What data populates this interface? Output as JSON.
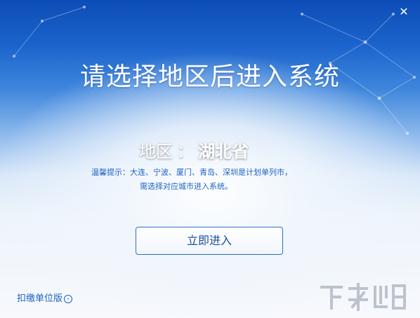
{
  "window": {
    "close_glyph": "✕"
  },
  "title": "请选择地区后进入系统",
  "region": {
    "label": "地区",
    "separator": "：",
    "value": "湖北省"
  },
  "tip": {
    "line1": "温馨提示：大连、宁波、厦门、青岛、深圳是计划单列市，",
    "line2": "需选择对应城市进入系统。"
  },
  "buttons": {
    "enter_label": "立即进入"
  },
  "footer": {
    "version_link": "扣缴单位版",
    "version_icon": "chevron-right-circle-icon"
  },
  "colors": {
    "accent": "#1b62c6",
    "header_blue": "#0d4cb6"
  }
}
